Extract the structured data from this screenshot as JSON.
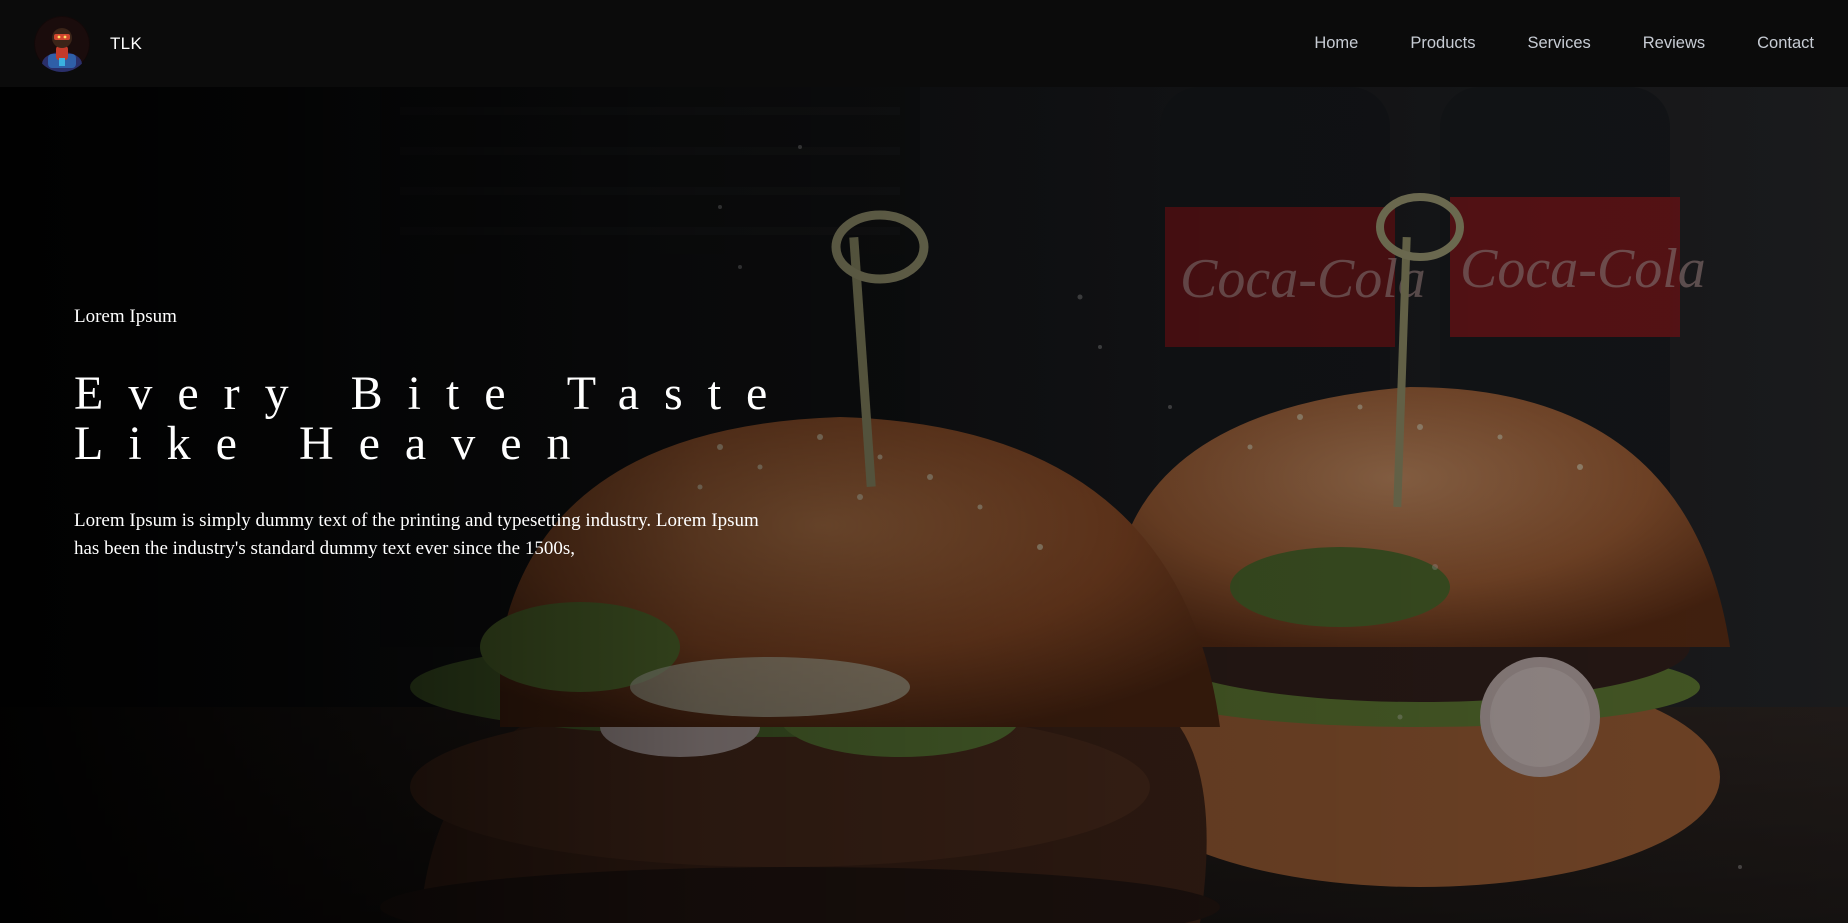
{
  "brand": {
    "name": "TLK",
    "logo_icon": "avatar-logo-icon"
  },
  "nav": {
    "items": [
      {
        "label": "Home"
      },
      {
        "label": "Products"
      },
      {
        "label": "Services"
      },
      {
        "label": "Reviews"
      },
      {
        "label": "Contact"
      }
    ]
  },
  "hero": {
    "eyebrow": "Lorem Ipsum",
    "headline_line1": "Every Bite Taste",
    "headline_line2": "Like Heaven",
    "lead": "Lorem Ipsum is simply dummy text of the printing and typesetting industry. Lorem Ipsum has been the industry's standard dummy text ever since the 1500s,"
  },
  "colors": {
    "nav_bg": "#0b0b0b",
    "nav_text": "#c7ccd4",
    "hero_text": "#ffffff"
  }
}
